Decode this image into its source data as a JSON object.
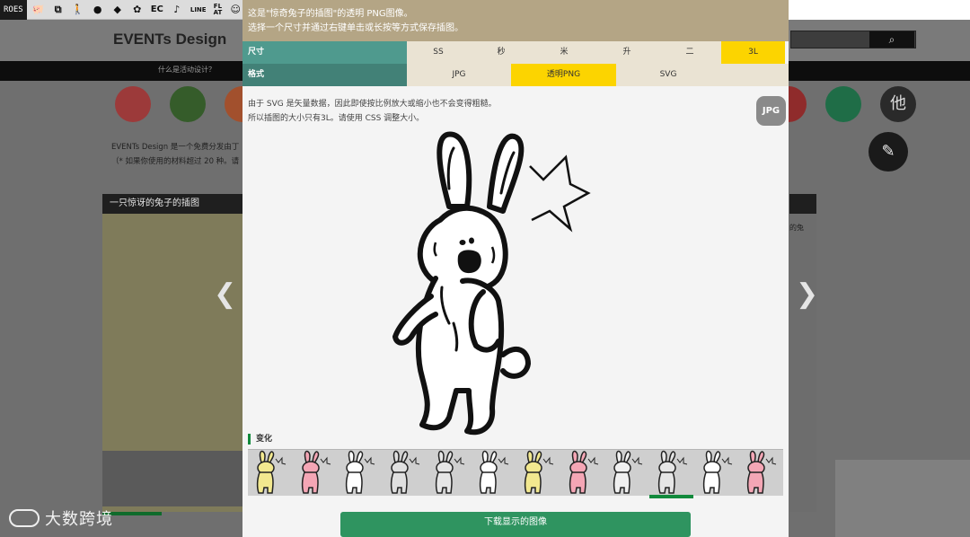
{
  "toolbar": {
    "tag": "ROES",
    "icons": [
      "pig-icon",
      "copy-icon",
      "person-icon",
      "speech-bubble-icon",
      "tag-icon",
      "flower-icon",
      "ec-icon",
      "note-icon",
      "line-icon",
      "flat-icon",
      "smile-icon",
      "p-icon",
      "image-icon"
    ],
    "ec_label": "EC",
    "line_label": "LINE",
    "flat_label": "FL\nAT",
    "p_label": "P"
  },
  "site": {
    "logo": "EVENTs Design",
    "nav_text": "什么是活动设计？",
    "desc_line1": "EVENTs Design 是一个免费分发由丁",
    "desc_line2": "（* 如果你使用的材料超过 20 种。请",
    "panel_title": "一只惊讶的兔子的插图",
    "right_text": "的兔",
    "other_label": "他",
    "circle_colors": [
      "#b13b3b",
      "#2f6d2f",
      "#d46b3e",
      "#ad2d2d",
      "#1d7a4a",
      "#2a2a2a"
    ]
  },
  "modal": {
    "header_line1": "这是\"惊奇兔子的插图\"的透明 PNG图像。",
    "header_line2": "选择一个尺寸并通过右键单击或长按等方式保存插图。",
    "size_label": "尺寸",
    "sizes": [
      "SS",
      "秒",
      "米",
      "升",
      "二",
      "3L"
    ],
    "selected_size": "3L",
    "format_label": "格式",
    "formats": [
      "JPG",
      "透明PNG",
      "SVG"
    ],
    "selected_format": "透明PNG",
    "note_line1": "由于 SVG 是矢量数据，因此即使按比例放大或缩小也不会变得粗糙。",
    "note_line2": "所以插图的大小只有3L。请使用 CSS 调整大小。",
    "jpg_badge": "JPG",
    "variations_label": "变化",
    "variation_colors": [
      "#f2e88f",
      "#f4a6b5",
      "#ffffff",
      "#e0e0e0",
      "#e6e6e6",
      "#ffffff",
      "#f2e88f",
      "#f4a6b5",
      "#f0f0f0",
      "#e6e6e6",
      "#ffffff",
      "#f4a6b5"
    ],
    "active_variation": 9,
    "download_label": "下载显示的图像"
  },
  "watermark": "大数跨境",
  "colors": {
    "accent_yellow": "#fcd400",
    "teal": "#4f9a8e",
    "header_tan": "#b4a585",
    "green": "#2f9460"
  }
}
